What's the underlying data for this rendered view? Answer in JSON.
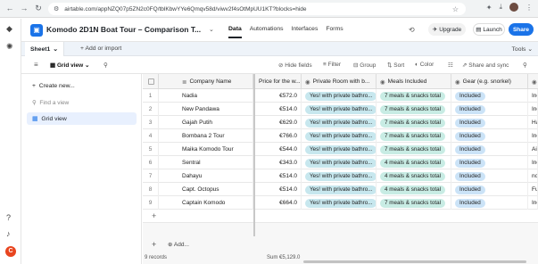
{
  "browser": {
    "url": "airtable.com/appNZQ07p5ZN2c0FQ/tblKbwYYe6Qmqv58d/viwv2f4sOtMpUU1KT?blocks=hide"
  },
  "header": {
    "title": "Komodo 2D1N Boat Tour – Comparison T...",
    "tabs": [
      "Data",
      "Automations",
      "Interfaces",
      "Forms"
    ],
    "active_tab": "Data",
    "upgrade_label": "Upgrade",
    "launch_label": "Launch",
    "share_label": "Share",
    "accent": "#1a73e8"
  },
  "tablebar": {
    "sheet_name": "Sheet1",
    "add_import": "Add or import",
    "tools": "Tools"
  },
  "viewbar": {
    "view_name": "Grid view",
    "hide_fields": "Hide fields",
    "filter": "Filter",
    "group": "Group",
    "sort": "Sort",
    "color": "Color",
    "share_sync": "Share and sync"
  },
  "sidebar": {
    "create_new": "Create new...",
    "find_placeholder": "Find a view",
    "grid_view": "Grid view"
  },
  "grid": {
    "columns": [
      "Company Name",
      "Price for the w...",
      "Private Room with b...",
      "Meals Included",
      "Gear (e.g. snorkel)"
    ],
    "rows": [
      {
        "n": "1",
        "company": "Nadia",
        "price": "€572.0",
        "room": "Yes! with private bathro...",
        "meals": "7 meals & snacks total",
        "gear": "Included",
        "extra": "Incl"
      },
      {
        "n": "2",
        "company": "New Pandawa",
        "price": "€514.0",
        "room": "Yes! with private bathro...",
        "meals": "7 meals & snacks total",
        "gear": "Included",
        "extra": "Incl"
      },
      {
        "n": "3",
        "company": "Gajah Putih",
        "price": "€629.0",
        "room": "Yes! with private bathro...",
        "meals": "7 meals & snacks total",
        "gear": "Included",
        "extra": "Hai"
      },
      {
        "n": "4",
        "company": "Bombana 2 Tour",
        "price": "€766.0",
        "room": "Yes! with private bathro...",
        "meals": "7 meals & snacks total",
        "gear": "Included",
        "extra": "Incl"
      },
      {
        "n": "5",
        "company": "Maika Komodo Tour",
        "price": "€544.0",
        "room": "Yes! with private bathro...",
        "meals": "7 meals & snacks total",
        "gear": "Included",
        "extra": "Air"
      },
      {
        "n": "6",
        "company": "Sentral",
        "price": "€343.0",
        "room": "Yes! with private bathro...",
        "meals": "4 meals & snacks total",
        "gear": "Included",
        "extra": "Incl"
      },
      {
        "n": "7",
        "company": "Dahayu",
        "price": "€514.0",
        "room": "Yes! with private bathro...",
        "meals": "4 meals & snacks total",
        "gear": "Included",
        "extra": "not"
      },
      {
        "n": "8",
        "company": "Capt. Octopus",
        "price": "€514.0",
        "room": "Yes! with private bathro...",
        "meals": "4 meals & snacks total",
        "gear": "Included",
        "extra": "Full"
      },
      {
        "n": "9",
        "company": "Captain Komodo",
        "price": "€664.0",
        "room": "Yes! with private bathro...",
        "meals": "7 meals & snacks total",
        "gear": "Included",
        "extra": "Incl"
      }
    ],
    "add_label": "Add...",
    "records": "9 records",
    "sum": "Sum €5,129.0"
  },
  "colors": {
    "room_pill": "#c7e7ee",
    "meal_pill": "#c8ece4",
    "included_pill": "#cbe3f7",
    "avatar": "#e8451f"
  }
}
